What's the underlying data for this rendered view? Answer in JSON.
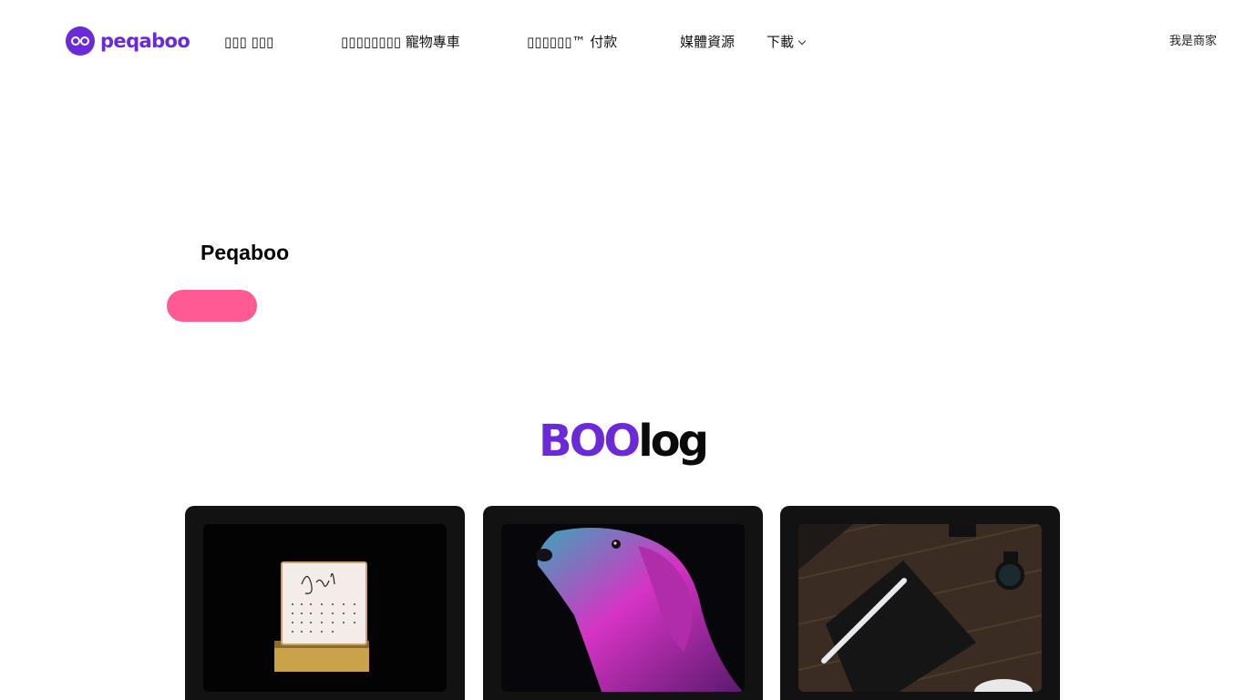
{
  "header": {
    "logo_text": "peqaboo",
    "nav": [
      {
        "label": "▯▯▯ ▯▯▯"
      },
      {
        "label": "▯▯▯▯▯▯▯▯ 寵物專車"
      },
      {
        "label": "▯▯▯▯▯▯™ 付款"
      },
      {
        "label": "媒體資源"
      },
      {
        "label": "下載"
      }
    ],
    "merchant_label": "我是商家"
  },
  "hero": {
    "title": "Peqaboo",
    "button_color": "#ff5a93"
  },
  "blog": {
    "heading_part1": "BOO",
    "heading_part2": "log",
    "cards": [
      {
        "image": "calendar-photo"
      },
      {
        "image": "neon-dog-photo"
      },
      {
        "image": "notebook-pen-photo"
      }
    ]
  },
  "colors": {
    "brand": "#6a2ad8",
    "accent": "#ff5a93",
    "card_bg": "#121212"
  }
}
